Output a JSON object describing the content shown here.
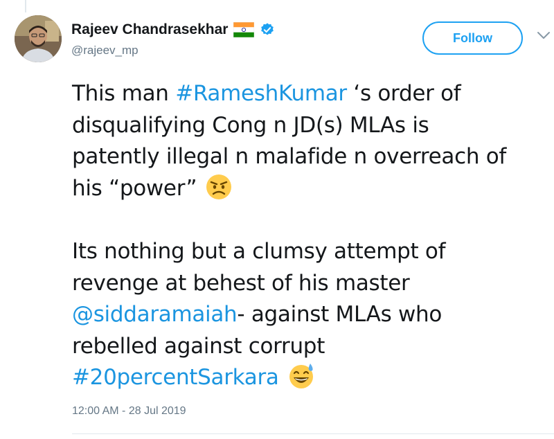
{
  "tweet": {
    "author": {
      "name": "Rajeev Chandrasekhar",
      "handle": "@rajeev_mp",
      "flag_icon": "india-flag-icon",
      "verified_icon": "verified-badge-icon"
    },
    "follow_label": "Follow",
    "text_lines": [
      [
        {
          "t": "This man "
        },
        {
          "t": "#RameshKumar",
          "link": true
        },
        {
          "t": " ‘s  order of"
        }
      ],
      [
        {
          "t": "disqualifying Cong n JD(s) MLAs is"
        }
      ],
      [
        {
          "t": "patently illegal n malafide n overreach of"
        }
      ],
      [
        {
          "t": "his “power”"
        }
      ],
      [],
      [
        {
          "t": "Its nothing but a clumsy attempt of"
        }
      ],
      [
        {
          "t": "revenge at behest of his master"
        }
      ],
      [
        {
          "t": "@siddaramaiah",
          "link": true
        },
        {
          "t": "-  against MLAs who"
        }
      ],
      [
        {
          "t": "rebelled against corrupt"
        }
      ],
      [
        {
          "t": "#20percentSarkara",
          "link": true
        }
      ]
    ],
    "timestamp": "12:00 AM - 28 Jul 2019",
    "colors": {
      "link": "#1b95e0",
      "follow_border": "#1da1f2",
      "secondary_text": "#657786"
    }
  }
}
